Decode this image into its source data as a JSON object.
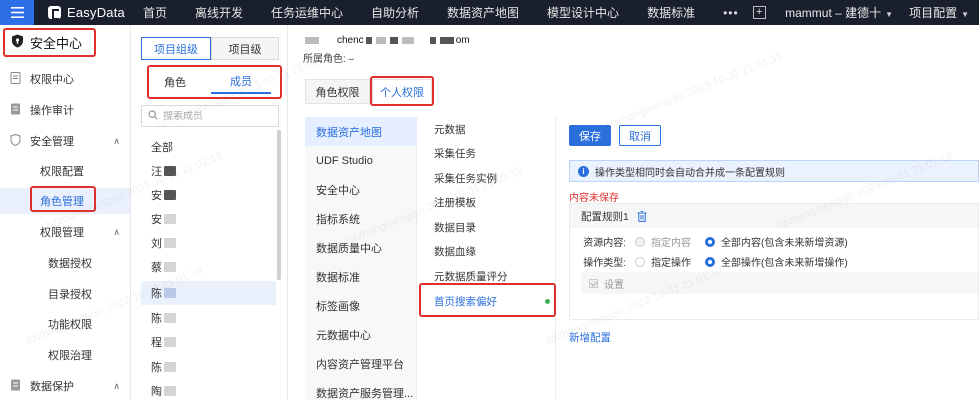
{
  "topbar": {
    "logo": "EasyData",
    "nav": [
      "首页",
      "离线开发",
      "任务运维中心",
      "自助分析",
      "数据资产地图",
      "模型设计中心",
      "数据标准"
    ],
    "more": "•••",
    "add": "+",
    "user": "mammut – 建德十",
    "config": "项目配置"
  },
  "sidebar": {
    "title": "安全中心",
    "items": {
      "perm_center": "权限中心",
      "audit": "操作审计",
      "security_mgmt": "安全管理",
      "perm_config": "权限配置",
      "role_mgmt": "角色管理",
      "perm_mgmt": "权限管理",
      "data_auth": "数据授权",
      "catalog_auth": "目录授权",
      "func_perm": "功能权限",
      "perm_gov": "权限治理",
      "data_protect": "数据保护"
    }
  },
  "members": {
    "seg_project_group": "项目组级",
    "seg_project": "项目级",
    "tab_role": "角色",
    "tab_member": "成员",
    "search_placeholder": "搜索成员",
    "list": [
      "全部",
      "汪",
      "安",
      "安",
      "刘",
      "蔡",
      "陈",
      "陈",
      "程",
      "陈",
      "陶"
    ]
  },
  "main": {
    "user_prefix": "chenc",
    "user_suffix": "om",
    "role_line": "所属角色: –",
    "tab_role_perm": "角色权限",
    "tab_personal_perm": "个人权限",
    "modules": [
      "数据资产地图",
      "UDF Studio",
      "安全中心",
      "指标系统",
      "数据质量中心",
      "数据标准",
      "标签画像",
      "元数据中心",
      "内容资产管理平台",
      "数据资产服务管理..."
    ],
    "subitems": [
      "元数据",
      "采集任务",
      "采集任务实例",
      "注册模板",
      "数据目录",
      "数据血缘",
      "元数据质量评分",
      "首页搜索偏好"
    ],
    "save": "保存",
    "cancel": "取消",
    "notice": "操作类型相同时会自动合并成一条配置规则",
    "unsaved": "内容未保存",
    "rule_title": "配置规则1",
    "resource_label": "资源内容:",
    "resource_opt1": "指定内容",
    "resource_opt2": "全部内容(包含未来新增资源)",
    "op_label": "操作类型:",
    "op_opt1": "指定操作",
    "op_opt2": "全部操作(包含未来新增操作)",
    "setting": "设置",
    "add_rule": "新增配置"
  },
  "watermark": "hzzhangmengqin 2023-10-31 21:01:19",
  "colors": {
    "accent": "#2a6fdb",
    "highlight": "#e0302b",
    "topbar": "#1a1f2e"
  }
}
